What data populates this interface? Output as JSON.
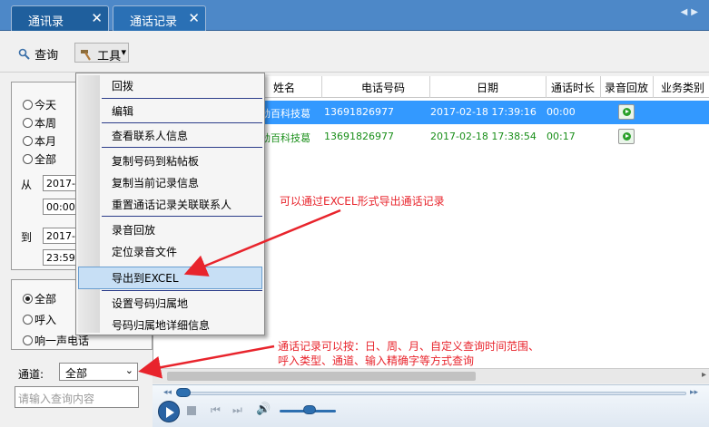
{
  "tabs": [
    {
      "label": "通讯录",
      "close": "✕"
    },
    {
      "label": "通话记录",
      "close": "✕"
    }
  ],
  "toolbar": {
    "query_label": "查询",
    "tools_label": "工具",
    "dropdown_glyph": "▾"
  },
  "filters": {
    "time_options": [
      "今天",
      "本周",
      "本月",
      "全部"
    ],
    "from_label": "从",
    "to_label": "到",
    "from_date": "2017-0",
    "from_time": "00:00",
    "to_date": "2017-0",
    "to_time": "23:59",
    "call_types": [
      "全部",
      "呼入",
      "响一声电话"
    ],
    "channel_label": "通道:",
    "channel_value": "全部",
    "search_placeholder": "请输入查询内容"
  },
  "grid": {
    "columns": [
      "姓名",
      "电话号码",
      "日期",
      "通话时长",
      "录音回放",
      "业务类别"
    ],
    "rows": [
      {
        "name": "劲百科技葛",
        "phone": "13691826977",
        "date": "2017-02-18 17:39:16",
        "duration": "00:00"
      },
      {
        "name": "劲百科技葛",
        "phone": "13691826977",
        "date": "2017-02-18 17:38:54",
        "duration": "00:17"
      }
    ]
  },
  "menu": {
    "items": [
      "回拨",
      "编辑",
      "查看联系人信息",
      "复制号码到粘帖板",
      "复制当前记录信息",
      "重置通话记录关联联系人",
      "录音回放",
      "定位录音文件",
      "导出到EXCEL",
      "设置号码归属地",
      "号码归属地详细信息"
    ]
  },
  "annotations": {
    "export_note": "可以通过EXCEL形式导出通话记录",
    "query_note_line1": "通话记录可以按：日、周、月、自定义查询时间范围、",
    "query_note_line2": "呼入类型、通道、输入精确字等方式查询"
  },
  "colors": {
    "accent": "#3399ff",
    "tab_bg": "#4d88c8",
    "annotation": "#e8242c",
    "row_text": "#1a8f1a"
  }
}
